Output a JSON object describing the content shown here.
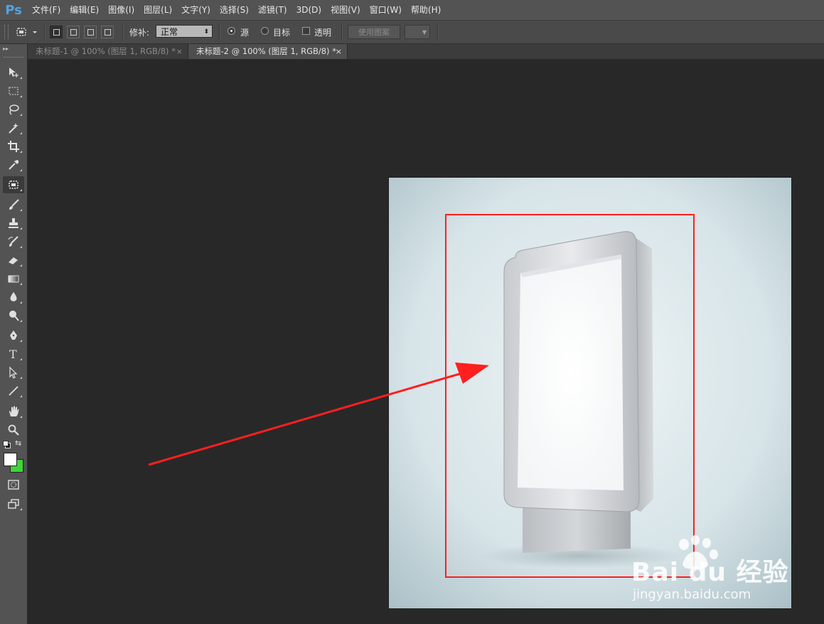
{
  "app": {
    "logo": "Ps"
  },
  "menu": [
    "文件(F)",
    "编辑(E)",
    "图像(I)",
    "图层(L)",
    "文字(Y)",
    "选择(S)",
    "滤镜(T)",
    "3D(D)",
    "视图(V)",
    "窗口(W)",
    "帮助(H)"
  ],
  "options": {
    "patch_label": "修补:",
    "patch_value": "正常",
    "source_label": "源",
    "target_label": "目标",
    "transparent_label": "透明",
    "use_pattern_label": "使用图案",
    "source_selected": true
  },
  "tabs": [
    {
      "label": "未标题-1 @ 100% (图层 1, RGB/8) *",
      "close": "×",
      "active": false
    },
    {
      "label": "未标题-2 @ 100% (图层 1, RGB/8) *",
      "close": "×",
      "active": true
    }
  ],
  "toolbar": {
    "active_tool": "patch-tool",
    "foreground_color": "#ffffff",
    "background_color": "#3fd63a"
  },
  "canvas": {
    "annotation_color": "#ff1f1f"
  },
  "watermark": {
    "brand_text": "Bai du 经验",
    "url": "jingyan.baidu.com"
  }
}
